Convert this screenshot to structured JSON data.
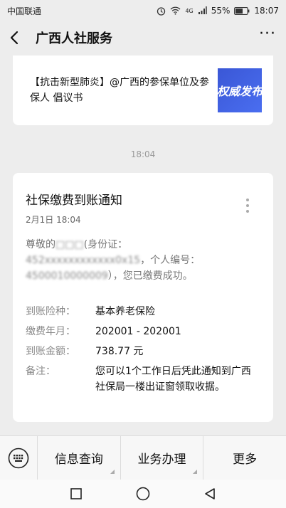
{
  "status_bar": {
    "carrier": "中国联通",
    "battery": "55%",
    "time": "18:07",
    "network": "4G"
  },
  "nav": {
    "title": "广西人社服务"
  },
  "article": {
    "text": "【抗击新型肺炎】@广西的参保单位及参保人 倡议书",
    "thumb_text": "权威发布"
  },
  "timestamp": "18:04",
  "notice": {
    "title": "社保缴费到账通知",
    "date": "2月1日  18:04",
    "greeting_prefix": "尊敬的",
    "greeting_name": "□□□",
    "greeting_id_label": "(身份证：",
    "greeting_id": "452xxxxxxxxxxxx0x15",
    "greeting_person_label": "，个人编号：",
    "greeting_person": "4500010000009",
    "greeting_suffix": "），您已缴费成功。",
    "fields": [
      {
        "label": "到账险种：",
        "value": "基本养老保险"
      },
      {
        "label": "缴费年月：",
        "value": "202001 - 202001"
      },
      {
        "label": "到账金额：",
        "value": "738.77 元"
      },
      {
        "label": "备注：",
        "value": "您可以1个工作日后凭此通知到广西社保局一楼出证窗领取收据。"
      }
    ]
  },
  "menu": {
    "items": [
      "信息查询",
      "业务办理",
      "更多"
    ]
  }
}
